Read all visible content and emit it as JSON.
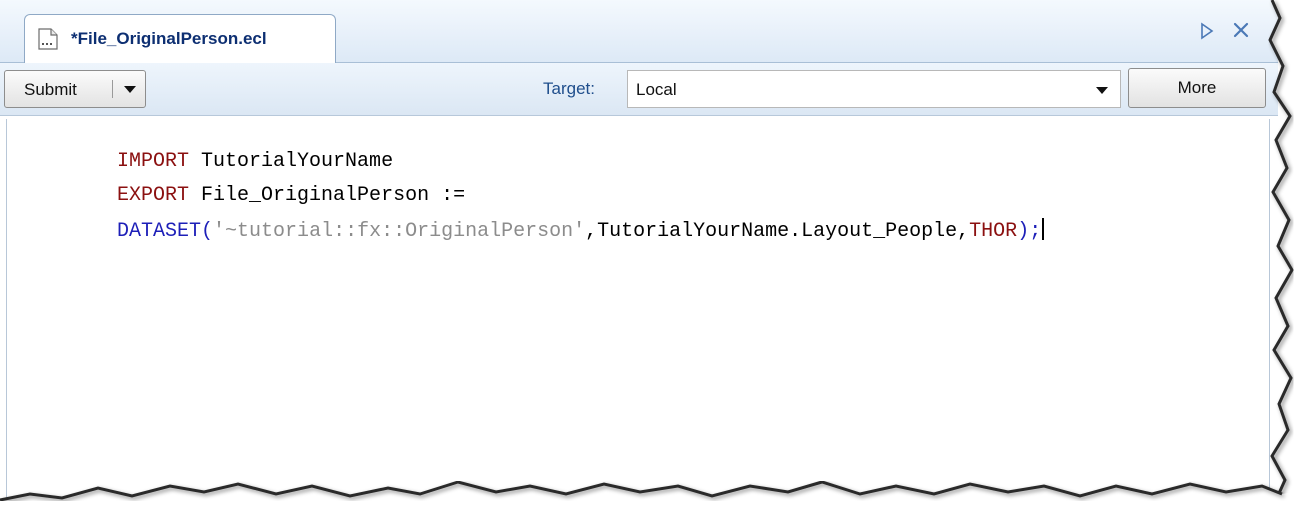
{
  "tab": {
    "title": "*File_OriginalPerson.ecl",
    "icon": "ecl-file-icon"
  },
  "tabstrip": {
    "next_icon": "triangle-right-icon",
    "close_icon": "close-icon",
    "accent_color": "#4b79b6"
  },
  "toolbar": {
    "submit_label": "Submit",
    "submit_dropdown_icon": "caret-down-icon",
    "target_label": "Target:",
    "target_value": "Local",
    "more_label": "More"
  },
  "editor": {
    "lines": [
      {
        "tokens": [
          {
            "text": "IMPORT",
            "kind": "keyword-red"
          },
          {
            "text": " TutorialYourName",
            "kind": "plain"
          }
        ]
      },
      {
        "tokens": [
          {
            "text": "EXPORT",
            "kind": "keyword-red"
          },
          {
            "text": " File_OriginalPerson :=",
            "kind": "plain"
          }
        ]
      },
      {
        "tokens": [
          {
            "text": "DATASET",
            "kind": "keyword-blue"
          },
          {
            "text": "(",
            "kind": "keyword-blue"
          },
          {
            "text": "'~tutorial::fx::OriginalPerson'",
            "kind": "string"
          },
          {
            "text": ",TutorialYourName.Layout_People,",
            "kind": "plain"
          },
          {
            "text": "THOR",
            "kind": "keyword-red"
          },
          {
            "text": ");",
            "kind": "keyword-blue"
          }
        ]
      }
    ],
    "colors": {
      "keyword_red": "#8b1010",
      "keyword_blue": "#1d1fb8",
      "string": "#8c8c8c",
      "plain": "#000000"
    }
  }
}
